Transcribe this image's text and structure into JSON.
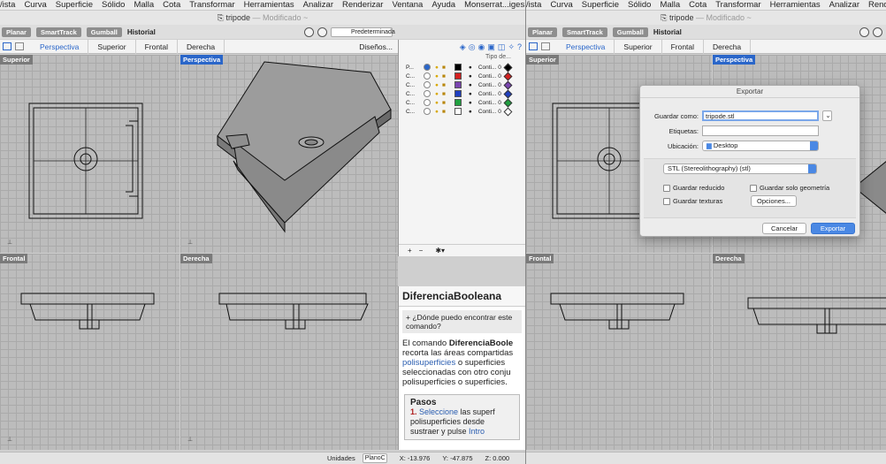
{
  "left": {
    "menu": [
      "/ista",
      "Curva",
      "Superficie",
      "Sólido",
      "Malla",
      "Cota",
      "Transformar",
      "Herramientas",
      "Analizar",
      "Renderizar",
      "Ventana",
      "Ayuda",
      "Monserrat...iges L"
    ],
    "title": "tripode",
    "title_mod": "— Modificado ~",
    "toolbar": {
      "planar": "Planar",
      "smarttrack": "SmartTrack",
      "gumball": "Gumball",
      "historial": "Historial",
      "layer": "Predeterminada"
    },
    "tabs": [
      "Perspectiva",
      "Superior",
      "Frontal",
      "Derecha"
    ],
    "tab_right": "Diseños...",
    "viewports": {
      "top": "Superior",
      "persp": "Perspectiva",
      "front": "Frontal",
      "right": "Derecha"
    },
    "layers": {
      "header_type": "Tipo de...",
      "rows": [
        {
          "name": "P...",
          "color": "#000000",
          "type": "Conti... 0",
          "active": true
        },
        {
          "name": "C...",
          "color": "#d42020",
          "type": "Conti... 0",
          "active": false
        },
        {
          "name": "C...",
          "color": "#7a45b0",
          "type": "Conti... 0",
          "active": false
        },
        {
          "name": "C...",
          "color": "#2040c0",
          "type": "Conti... 0",
          "active": false
        },
        {
          "name": "C...",
          "color": "#20a040",
          "type": "Conti... 0",
          "active": false
        },
        {
          "name": "C...",
          "color": "#ffffff",
          "type": "Conti... 0",
          "active": false
        }
      ]
    },
    "help": {
      "title": "DiferenciaBooleana",
      "question": "¿Dónde puedo encontrar este comando?",
      "body_pre": "El comando",
      "body_cmd": "DiferenciaBoole",
      "body_2": "recorta las áreas compartidas",
      "body_link": "polisuperficies",
      "body_3": "o superficies seleccionadas con otro conju polisuperficies o superficies.",
      "steps_title": "Pasos",
      "step1_link": "Seleccione",
      "step1_text": "las superf polisuperficies desde sustraer y pulse",
      "step1_key": "Intro"
    },
    "status": {
      "units": "Unidades",
      "plane": "PlanoC",
      "x": "X: -13.976",
      "y": "Y: -47.875",
      "z": "Z: 0.000"
    }
  },
  "right": {
    "menu": [
      "/ista",
      "Curva",
      "Superficie",
      "Sólido",
      "Malla",
      "Cota",
      "Transformar",
      "Herramientas",
      "Analizar",
      "Renderizar"
    ],
    "title": "tripode",
    "title_mod": "— Modificado ~",
    "toolbar": {
      "planar": "Planar",
      "smarttrack": "SmartTrack",
      "gumball": "Gumball",
      "historial": "Historial"
    },
    "tabs": [
      "Perspectiva",
      "Superior",
      "Frontal",
      "Derecha"
    ],
    "viewports": {
      "top": "Superior",
      "persp": "Perspectiva",
      "front": "Frontal",
      "right": "Derecha"
    },
    "dialog": {
      "title": "Exportar",
      "save_as_label": "Guardar como:",
      "save_as_value": "tripode.stl",
      "tags_label": "Etiquetas:",
      "tags_value": "",
      "location_label": "Ubicación:",
      "location_value": "Desktop",
      "format": "STL (Stereolithography) (stl)",
      "cb_reduced": "Guardar reducido",
      "cb_geometry": "Guardar solo geometría",
      "cb_textures": "Guardar texturas",
      "options": "Opciones...",
      "cancel": "Cancelar",
      "export": "Exportar"
    }
  }
}
